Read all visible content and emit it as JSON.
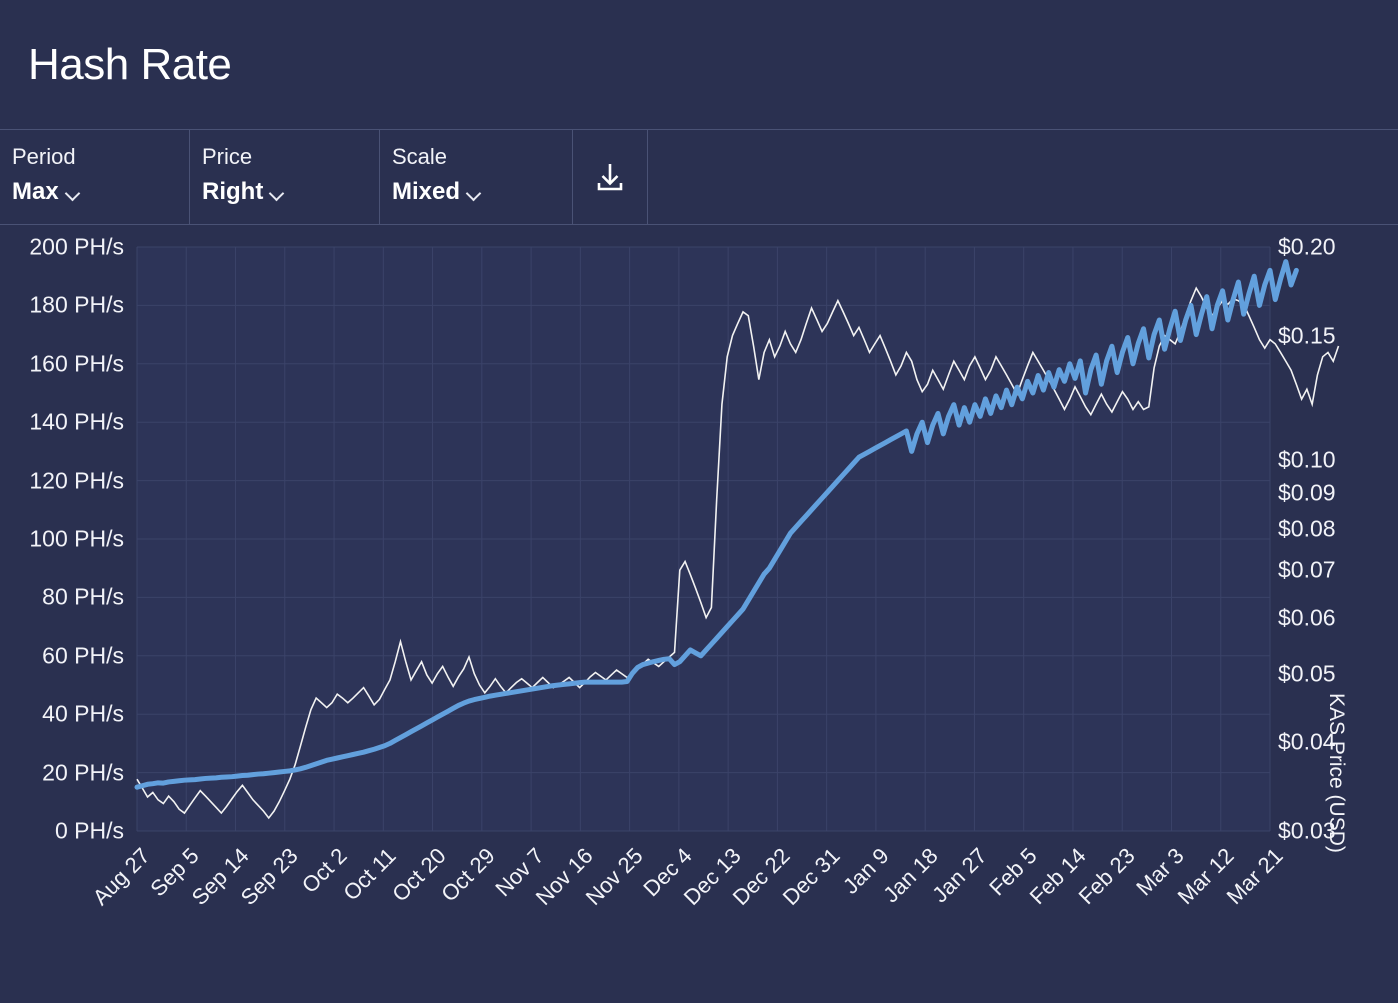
{
  "header": {
    "title": "Hash Rate"
  },
  "toolbar": {
    "period": {
      "label": "Period",
      "value": "Max"
    },
    "price": {
      "label": "Price",
      "value": "Right"
    },
    "scale": {
      "label": "Scale",
      "value": "Mixed"
    },
    "download_icon": "download-icon"
  },
  "colors": {
    "background": "#2a3050",
    "plot_background": "#2d3458",
    "grid": "#3b4369",
    "hashrate_line": "#62a0dd",
    "price_line": "#f2f2f2",
    "text": "#f2f3f8",
    "divider": "#4a5275"
  },
  "chart_data": {
    "type": "line",
    "title": "Hash Rate",
    "xlabel": "",
    "ylabel": "PH/s",
    "y2label": "KAS Price (USD)",
    "grid": true,
    "legend": "none",
    "y_left_scale": "linear",
    "y_left_range": [
      0,
      200
    ],
    "y_left_ticks": [
      "0 PH/s",
      "20 PH/s",
      "40 PH/s",
      "60 PH/s",
      "80 PH/s",
      "100 PH/s",
      "120 PH/s",
      "140 PH/s",
      "160 PH/s",
      "180 PH/s",
      "200 PH/s"
    ],
    "y_left_tick_values": [
      0,
      20,
      40,
      60,
      80,
      100,
      120,
      140,
      160,
      180,
      200
    ],
    "y_right_scale": "log",
    "y_right_range": [
      0.03,
      0.2
    ],
    "y_right_ticks": [
      "$0.03",
      "$0.04",
      "$0.05",
      "$0.06",
      "$0.07",
      "$0.08",
      "$0.09",
      "$0.10",
      "$0.15",
      "$0.20"
    ],
    "y_right_tick_values": [
      0.03,
      0.04,
      0.05,
      0.06,
      0.07,
      0.08,
      0.09,
      0.1,
      0.15,
      0.2
    ],
    "x_tick_labels": [
      "Aug 27",
      "Sep 5",
      "Sep 14",
      "Sep 23",
      "Oct 2",
      "Oct 11",
      "Oct 20",
      "Oct 29",
      "Nov 7",
      "Nov 16",
      "Nov 25",
      "Dec 4",
      "Dec 13",
      "Dec 22",
      "Dec 31",
      "Jan 9",
      "Jan 18",
      "Jan 27",
      "Feb 5",
      "Feb 14",
      "Feb 23",
      "Mar 3",
      "Mar 12",
      "Mar 21"
    ],
    "x_tick_step_days": 9,
    "n_points": 216,
    "series": [
      {
        "name": "Hash Rate",
        "axis": "left",
        "unit": "PH/s",
        "color": "#62a0dd",
        "width": 5,
        "values": [
          15,
          15.5,
          16,
          16.2,
          16.5,
          16.4,
          16.8,
          17,
          17.2,
          17.4,
          17.5,
          17.6,
          17.8,
          18,
          18.1,
          18.2,
          18.4,
          18.5,
          18.6,
          18.8,
          19,
          19.1,
          19.3,
          19.5,
          19.6,
          19.8,
          20,
          20.2,
          20.4,
          20.6,
          20.9,
          21.3,
          21.8,
          22.4,
          23,
          23.6,
          24.2,
          24.6,
          25,
          25.4,
          25.8,
          26.2,
          26.6,
          27,
          27.5,
          28,
          28.6,
          29.2,
          30,
          31,
          32,
          33,
          34,
          35,
          36,
          37,
          38,
          39,
          40,
          41,
          42,
          43,
          43.8,
          44.5,
          45,
          45.4,
          45.8,
          46.2,
          46.5,
          46.8,
          47.1,
          47.4,
          47.7,
          48,
          48.3,
          48.6,
          48.9,
          49.2,
          49.5,
          49.8,
          50,
          50.2,
          50.4,
          50.6,
          50.8,
          51,
          51,
          51,
          51,
          51,
          51,
          51,
          51,
          51.2,
          54,
          56,
          57,
          57.5,
          58,
          58.4,
          58.8,
          59,
          57,
          58,
          60,
          62,
          61,
          60,
          62,
          64,
          66,
          68,
          70,
          72,
          74,
          76,
          79,
          82,
          85,
          88,
          90,
          93,
          96,
          99,
          102,
          104,
          106,
          108,
          110,
          112,
          114,
          116,
          118,
          120,
          122,
          124,
          126,
          128,
          129,
          130,
          131,
          132,
          133,
          134,
          135,
          136,
          137,
          130,
          136,
          140,
          133,
          139,
          143,
          136,
          142,
          146,
          139,
          145,
          140,
          146,
          142,
          148,
          143,
          149,
          145,
          151,
          146,
          152,
          148,
          154,
          150,
          156,
          151,
          157,
          152,
          158,
          154,
          160,
          155,
          161,
          150,
          158,
          163,
          153,
          161,
          166,
          157,
          164,
          169,
          160,
          167,
          172,
          162,
          170,
          175,
          165,
          172,
          178,
          168,
          175,
          180,
          170,
          177,
          183,
          172,
          180,
          185,
          175,
          182,
          188,
          177,
          184,
          190,
          180,
          187,
          192,
          182,
          189,
          195,
          187,
          192
        ]
      },
      {
        "name": "KAS Price",
        "axis": "right",
        "unit": "USD",
        "color": "#f2f2f2",
        "width": 1.6,
        "values": [
          0.0355,
          0.0345,
          0.0335,
          0.034,
          0.0332,
          0.0328,
          0.0336,
          0.033,
          0.0322,
          0.0318,
          0.0326,
          0.0334,
          0.0342,
          0.0336,
          0.033,
          0.0324,
          0.0318,
          0.0325,
          0.0333,
          0.0341,
          0.0348,
          0.034,
          0.0332,
          0.0326,
          0.032,
          0.0313,
          0.032,
          0.033,
          0.0342,
          0.0355,
          0.0372,
          0.0395,
          0.042,
          0.0445,
          0.0462,
          0.0455,
          0.0448,
          0.0455,
          0.0468,
          0.0462,
          0.0455,
          0.0462,
          0.047,
          0.0478,
          0.0465,
          0.0452,
          0.046,
          0.0475,
          0.049,
          0.052,
          0.0555,
          0.052,
          0.049,
          0.0505,
          0.052,
          0.0498,
          0.0485,
          0.05,
          0.0512,
          0.0495,
          0.048,
          0.0495,
          0.0508,
          0.0528,
          0.05,
          0.0482,
          0.047,
          0.048,
          0.0492,
          0.048,
          0.047,
          0.0478,
          0.0486,
          0.0492,
          0.0485,
          0.0478,
          0.0486,
          0.0494,
          0.0486,
          0.0478,
          0.0482,
          0.0488,
          0.0494,
          0.0486,
          0.0478,
          0.0486,
          0.0495,
          0.0502,
          0.0496,
          0.049,
          0.0498,
          0.0506,
          0.05,
          0.0494,
          0.05,
          0.0508,
          0.0516,
          0.0524,
          0.0518,
          0.0512,
          0.052,
          0.0528,
          0.0536,
          0.07,
          0.072,
          0.069,
          0.066,
          0.063,
          0.06,
          0.062,
          0.088,
          0.12,
          0.14,
          0.15,
          0.156,
          0.162,
          0.16,
          0.145,
          0.13,
          0.142,
          0.148,
          0.14,
          0.145,
          0.152,
          0.146,
          0.142,
          0.148,
          0.156,
          0.164,
          0.158,
          0.152,
          0.156,
          0.162,
          0.168,
          0.162,
          0.156,
          0.15,
          0.154,
          0.148,
          0.142,
          0.146,
          0.15,
          0.144,
          0.138,
          0.132,
          0.136,
          0.142,
          0.138,
          0.13,
          0.125,
          0.128,
          0.134,
          0.13,
          0.126,
          0.132,
          0.138,
          0.134,
          0.13,
          0.136,
          0.14,
          0.135,
          0.13,
          0.134,
          0.14,
          0.136,
          0.132,
          0.128,
          0.124,
          0.13,
          0.136,
          0.142,
          0.138,
          0.134,
          0.13,
          0.126,
          0.122,
          0.118,
          0.122,
          0.127,
          0.123,
          0.119,
          0.116,
          0.12,
          0.124,
          0.12,
          0.117,
          0.121,
          0.125,
          0.122,
          0.118,
          0.121,
          0.118,
          0.119,
          0.135,
          0.145,
          0.15,
          0.148,
          0.146,
          0.152,
          0.16,
          0.168,
          0.175,
          0.17,
          0.164,
          0.16,
          0.164,
          0.168,
          0.166,
          0.169,
          0.168,
          0.166,
          0.16,
          0.154,
          0.148,
          0.144,
          0.148,
          0.146,
          0.142,
          0.138,
          0.134,
          0.128,
          0.122,
          0.126,
          0.12,
          0.132,
          0.14,
          0.142,
          0.138,
          0.145
        ]
      }
    ]
  }
}
